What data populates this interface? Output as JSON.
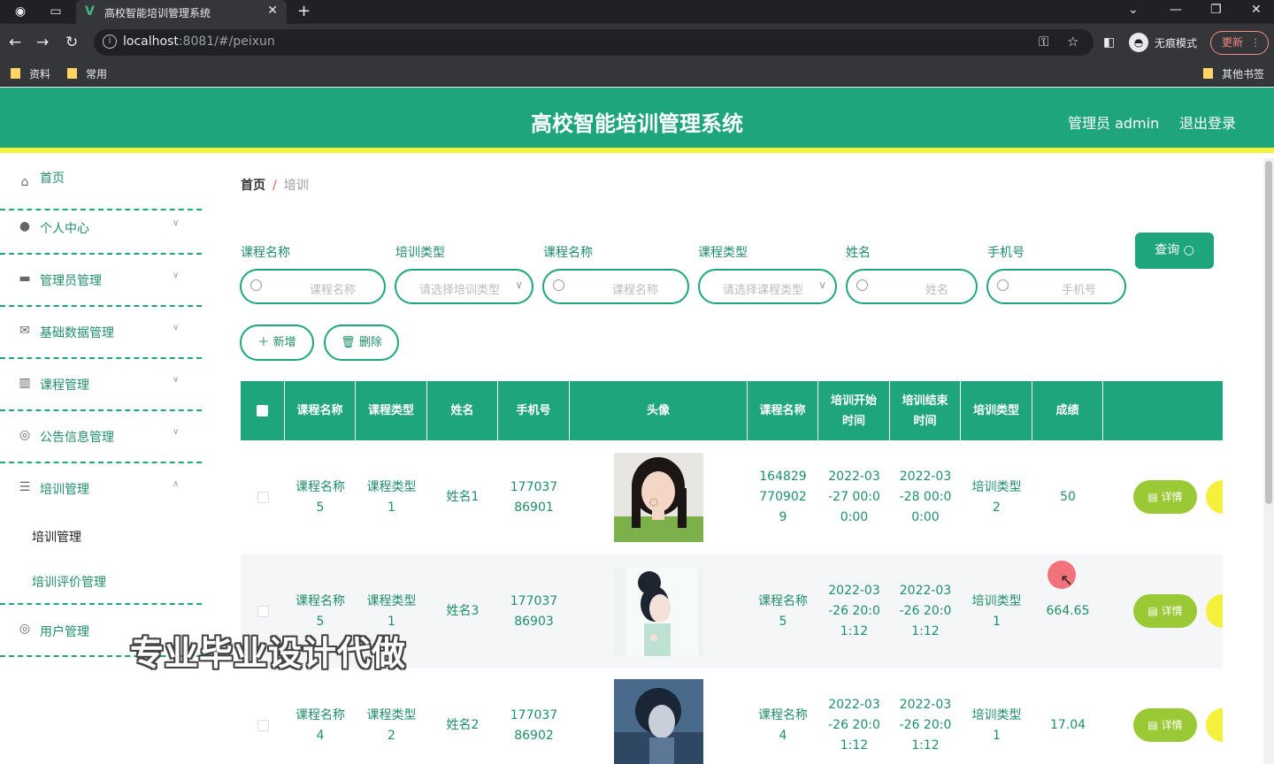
{
  "browser": {
    "tab_title": "高校智能培训管理系统",
    "tab_logo": "V",
    "url_host": "localhost",
    "url_rest": ":8081/#/peixun",
    "incognito_label": "无痕模式",
    "update_label": "更新",
    "bookmarks": [
      "资料",
      "常用"
    ],
    "other_bookmarks": "其他书签"
  },
  "header": {
    "title": "高校智能培训管理系统",
    "user": "管理员 admin",
    "logout": "退出登录"
  },
  "sidebar": {
    "items": [
      {
        "label": "首页",
        "icon": "home-icon"
      },
      {
        "label": "个人中心",
        "icon": "user-icon"
      },
      {
        "label": "管理员管理",
        "icon": "admin-icon"
      },
      {
        "label": "基础数据管理",
        "icon": "mail-icon"
      },
      {
        "label": "课程管理",
        "icon": "chart-icon"
      },
      {
        "label": "公告信息管理",
        "icon": "notice-icon"
      },
      {
        "label": "培训管理",
        "icon": "list-icon"
      },
      {
        "label": "用户管理",
        "icon": "users-icon"
      }
    ],
    "sub_items": [
      "培训管理",
      "培训评价管理"
    ]
  },
  "breadcrumb": {
    "home": "首页",
    "current": "培训"
  },
  "filters": [
    {
      "label": "课程名称",
      "placeholder": "课程名称"
    },
    {
      "label": "培训类型",
      "placeholder": "请选择培训类型"
    },
    {
      "label": "课程名称",
      "placeholder": "课程名称"
    },
    {
      "label": "课程类型",
      "placeholder": "请选择课程类型"
    },
    {
      "label": "姓名",
      "placeholder": "姓名"
    },
    {
      "label": "手机号",
      "placeholder": "手机号"
    }
  ],
  "actions": {
    "query": "查询",
    "add": "新增",
    "delete": "删除",
    "detail": "详情"
  },
  "table": {
    "headers": [
      "课程名称",
      "课程类型",
      "姓名",
      "手机号",
      "头像",
      "课程名称",
      "培训开始时间",
      "培训结束时间",
      "培训类型",
      "成绩"
    ],
    "rows": [
      {
        "course": "课程名称5",
        "course_type": "课程类型1",
        "name": "姓名1",
        "phone": "17703786901",
        "course2": "1648297709029",
        "start": "2022-03-27 00:00:00",
        "end": "2022-03-28 00:00:00",
        "train_type": "培训类型2",
        "score": "50"
      },
      {
        "course": "课程名称5",
        "course_type": "课程类型1",
        "name": "姓名3",
        "phone": "17703786903",
        "course2": "课程名称5",
        "start": "2022-03-26 20:01:12",
        "end": "2022-03-26 20:01:12",
        "train_type": "培训类型1",
        "score": "664.65"
      },
      {
        "course": "课程名称4",
        "course_type": "课程类型2",
        "name": "姓名2",
        "phone": "17703786902",
        "course2": "课程名称4",
        "start": "2022-03-26 20:01:12",
        "end": "2022-03-26 20:01:12",
        "train_type": "培训类型1",
        "score": "17.04"
      }
    ]
  },
  "watermark": "专业毕业设计代做",
  "colors": {
    "primary": "#1fa57c",
    "accent": "#f5f03c",
    "detail": "#9ac935"
  }
}
